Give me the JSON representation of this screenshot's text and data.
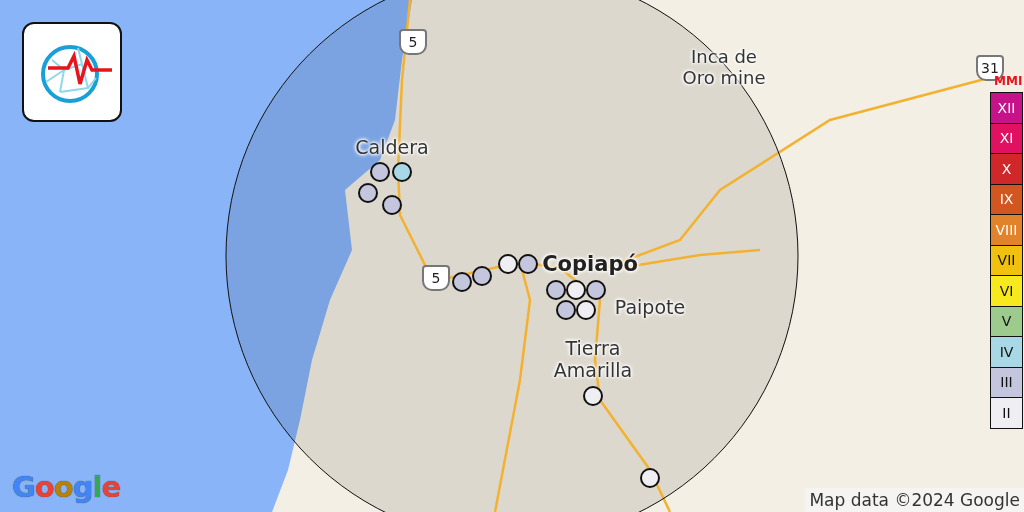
{
  "places": [
    {
      "name": "Inca de\nOro mine",
      "kind": "minor"
    },
    {
      "name": "Caldera",
      "kind": "town"
    },
    {
      "name": "Copiapó",
      "kind": "city"
    },
    {
      "name": "Paipote",
      "kind": "town"
    },
    {
      "name": "Tierra\nAmarilla",
      "kind": "town"
    }
  ],
  "road_shields": [
    "5",
    "5",
    "31"
  ],
  "events": [
    {
      "color": "#c3c6dd"
    },
    {
      "color": "#c3c6dd"
    },
    {
      "color": "#c3c6dd"
    },
    {
      "color": "#a8d8e5"
    },
    {
      "color": "#c3c6dd"
    },
    {
      "color": "#c3c6dd"
    },
    {
      "color": "#c3c6dd"
    },
    {
      "color": "#eeeef3"
    },
    {
      "color": "#c3c6dd"
    },
    {
      "color": "#eeeef3"
    },
    {
      "color": "#c3c6dd"
    },
    {
      "color": "#c3c6dd"
    },
    {
      "color": "#eeeef3"
    },
    {
      "color": "#eeeef3"
    },
    {
      "color": "#eeeef3"
    }
  ],
  "legend": {
    "title": "MMI",
    "levels": [
      {
        "label": "XII",
        "color": "#c6138a"
      },
      {
        "label": "XI",
        "color": "#df1160"
      },
      {
        "label": "X",
        "color": "#d0282a"
      },
      {
        "label": "IX",
        "color": "#d1561f"
      },
      {
        "label": "VIII",
        "color": "#e0832a"
      },
      {
        "label": "VII",
        "color": "#f0c20f"
      },
      {
        "label": "VI",
        "color": "#f6ea1f"
      },
      {
        "label": "V",
        "color": "#9dca8d"
      },
      {
        "label": "IV",
        "color": "#a8d8e5"
      },
      {
        "label": "III",
        "color": "#c3c6dd"
      },
      {
        "label": "II",
        "color": "#eeeef3"
      }
    ]
  },
  "map_logo": "Google",
  "attribution": "Map data ©2024 Google"
}
